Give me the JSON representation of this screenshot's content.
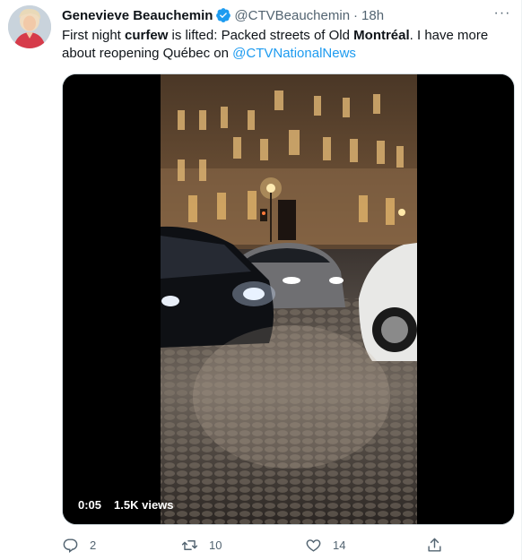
{
  "tweet": {
    "author_name": "Genevieve Beauchemin",
    "handle": "@CTVBeauchemin",
    "separator": "·",
    "time": "18h",
    "more_label": "···",
    "text": {
      "p1": "First night ",
      "b1": "curfew",
      "p2": " is lifted: Packed streets of Old ",
      "b2": "Montréal",
      "p3": ". I have more about reopening Québec on ",
      "mention": "@CTVNationalNews"
    },
    "video": {
      "duration": "0:05",
      "views": "1.5K views"
    },
    "actions": {
      "replies": "2",
      "retweets": "10",
      "likes": "14"
    },
    "colors": {
      "accent": "#1d9bf0",
      "verified": "#1d9bf0",
      "secondary_text": "#536471"
    },
    "icons": [
      "verified-badge-icon",
      "more-icon",
      "reply-icon",
      "retweet-icon",
      "like-icon",
      "share-icon"
    ]
  }
}
